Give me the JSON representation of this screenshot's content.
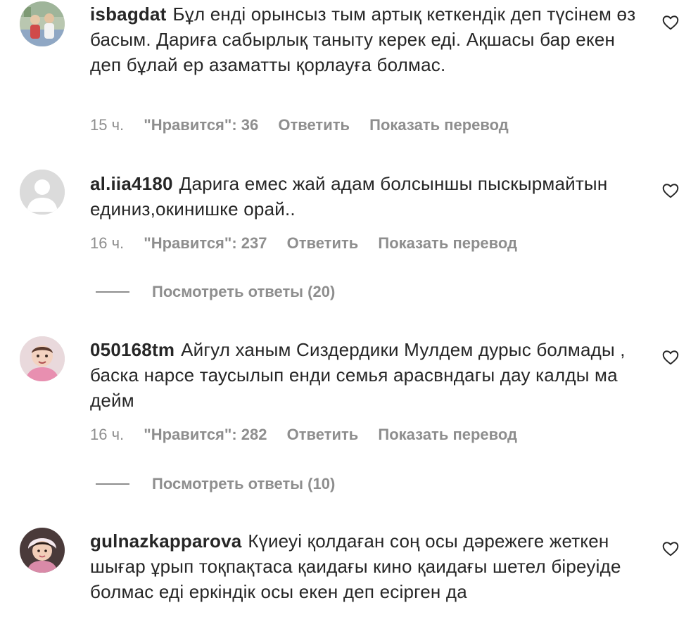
{
  "comments": [
    {
      "username": "isbagdat",
      "text": "Бұл енді орынсыз тым артық кеткендік деп түсінем өз басым. Дариға сабырлық таныту керек еді. Ақшасы бар екен деп бұлай ер азаматты қорлауға болмас.",
      "age": "15 ч.",
      "likes": "\"Нравится\": 36",
      "reply": "Ответить",
      "translate": "Показать перевод"
    },
    {
      "username": "al.iia4180",
      "text": "Дарига емес жай адам болсыншы пыскырмайтын единиз,окинишке орай..",
      "age": "16 ч.",
      "likes": "\"Нравится\": 237",
      "reply": "Ответить",
      "translate": "Показать перевод",
      "view_replies": "Посмотреть ответы (20)"
    },
    {
      "username": "050168tm",
      "text": "Айгул ханым Сиздердики Мулдем дурыс болмады , баска нарсе таусылып енди семья арасвндагы дау калды ма дейм",
      "age": "16 ч.",
      "likes": "\"Нравится\": 282",
      "reply": "Ответить",
      "translate": "Показать перевод",
      "view_replies": "Посмотреть ответы (10)"
    },
    {
      "username": "gulnazkapparova",
      "text": "Күиеуі қолдаған соң осы дәрежеге жеткен шығар ұрып тоқпақтаса қаидағы кино қаидағы шетел біреуіде болмас еді еркіндік осы екен деп есірген да"
    }
  ],
  "colors": {
    "text": "#262626",
    "secondary": "#8e8e8e"
  },
  "icons": {
    "like": "heart-outline-icon"
  }
}
